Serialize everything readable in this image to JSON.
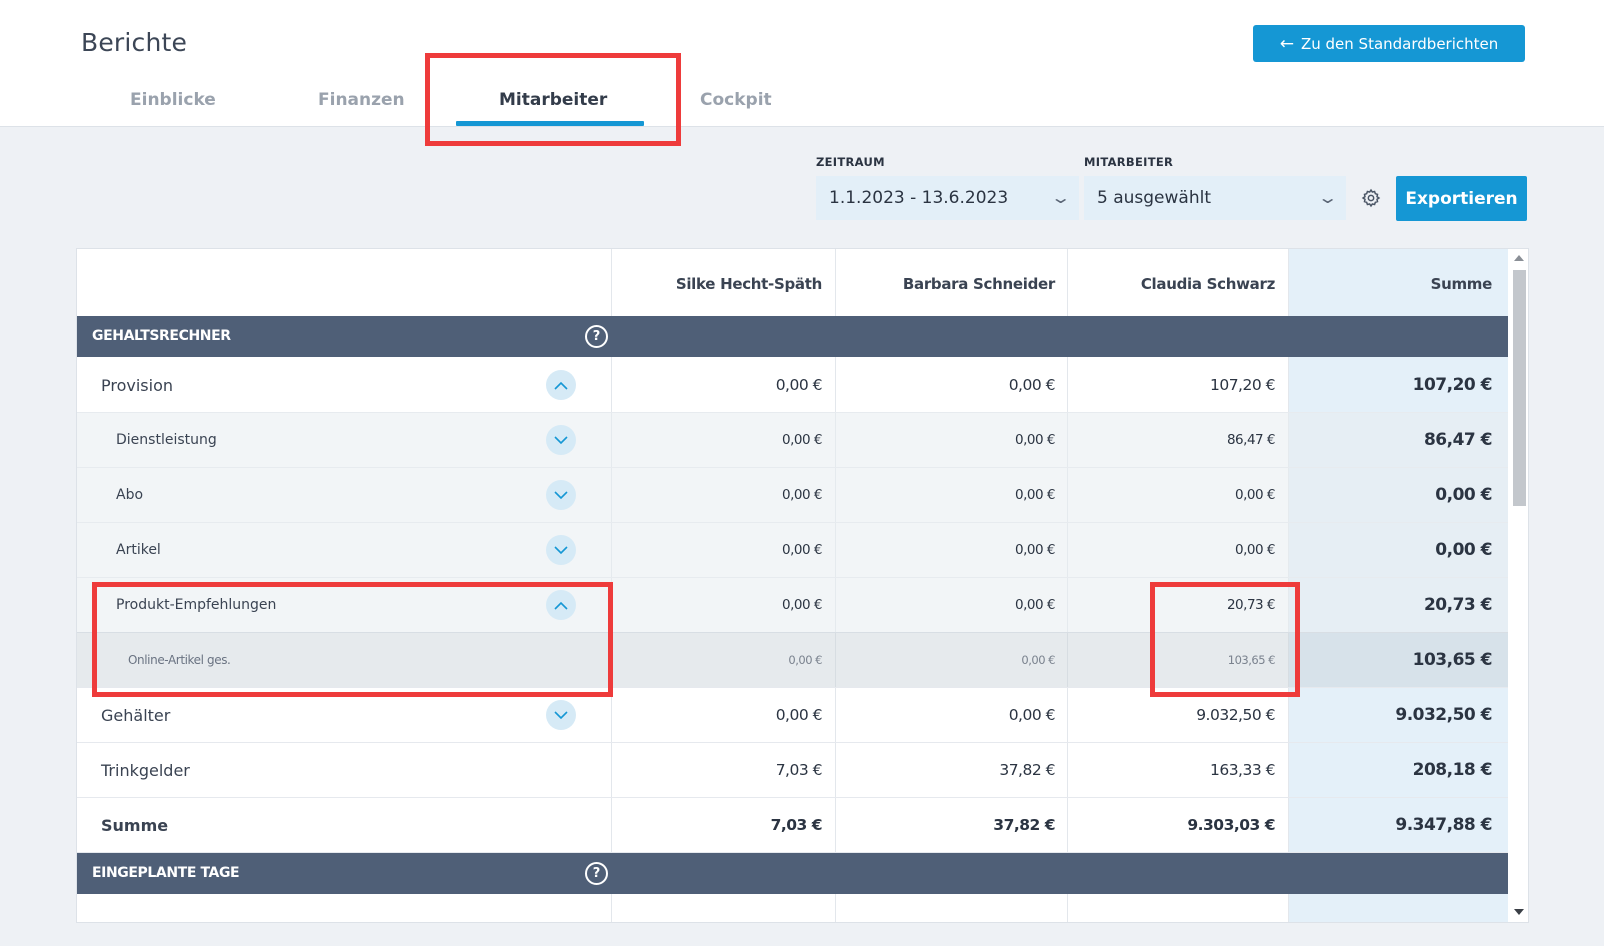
{
  "header": {
    "title": "Berichte",
    "back_button": "Zu den Standardberichten",
    "tabs": [
      {
        "label": "Einblicke"
      },
      {
        "label": "Finanzen"
      },
      {
        "label": "Mitarbeiter",
        "active": true
      },
      {
        "label": "Cockpit"
      }
    ]
  },
  "filters": {
    "zeitraum_label": "ZEITRAUM",
    "zeitraum_value": "1.1.2023 - 13.6.2023",
    "mitarbeiter_label": "MITARBEITER",
    "mitarbeiter_value": "5 ausgewählt",
    "export_button": "Exportieren"
  },
  "table": {
    "columns": [
      "Silke Hecht-Späth",
      "Barbara Schneider",
      "Claudia Schwarz",
      "Summe"
    ],
    "sections": [
      {
        "title": "GEHALTSRECHNER"
      },
      {
        "title": "EINGEPLANTE TAGE"
      }
    ],
    "rows": [
      {
        "label": "Provision",
        "values": [
          "0,00 €",
          "0,00 €",
          "107,20 €",
          "107,20 €"
        ],
        "expanded": true
      },
      {
        "label": "Dienstleistung",
        "values": [
          "0,00 €",
          "0,00 €",
          "86,47 €",
          "86,47 €"
        ],
        "expanded": false
      },
      {
        "label": "Abo",
        "values": [
          "0,00 €",
          "0,00 €",
          "0,00 €",
          "0,00 €"
        ],
        "expanded": false
      },
      {
        "label": "Artikel",
        "values": [
          "0,00 €",
          "0,00 €",
          "0,00 €",
          "0,00 €"
        ],
        "expanded": false
      },
      {
        "label": "Produkt-Empfehlungen",
        "values": [
          "0,00 €",
          "0,00 €",
          "20,73 €",
          "20,73 €"
        ],
        "expanded": true
      },
      {
        "label": "Online-Artikel ges.",
        "values": [
          "0,00 €",
          "0,00 €",
          "103,65 €",
          "103,65 €"
        ]
      },
      {
        "label": "Gehälter",
        "values": [
          "0,00 €",
          "0,00 €",
          "9.032,50 €",
          "9.032,50 €"
        ],
        "expanded": false
      },
      {
        "label": "Trinkgelder",
        "values": [
          "7,03 €",
          "37,82 €",
          "163,33 €",
          "208,18 €"
        ]
      },
      {
        "label": "Summe",
        "values": [
          "7,03 €",
          "37,82 €",
          "9.303,03 €",
          "9.347,88 €"
        ]
      }
    ]
  },
  "colors": {
    "accent": "#1597d4",
    "section_bar": "#4f5f77",
    "highlight": "#ee3b3b",
    "sum_column": "#e4f0f9"
  }
}
